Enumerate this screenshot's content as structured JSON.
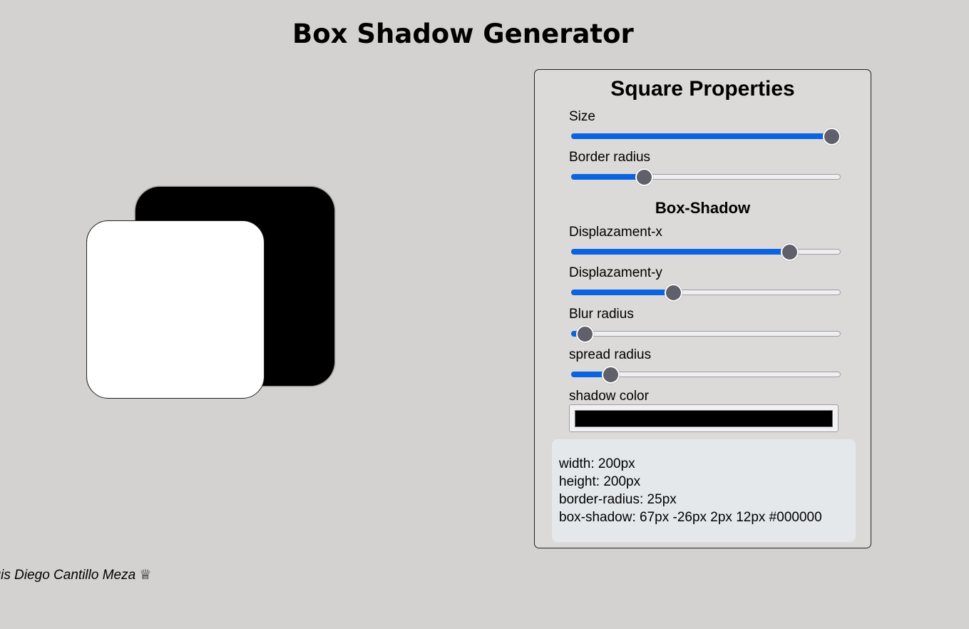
{
  "page": {
    "title": "Box Shadow Generator"
  },
  "panel": {
    "title": "Square Properties",
    "size": {
      "label": "Size",
      "value_fraction": 0.97
    },
    "border_radius": {
      "label": "Border radius",
      "value_fraction": 0.27
    },
    "box_shadow_title": "Box-Shadow",
    "displacement_x": {
      "label": "Displazament-x",
      "value_fraction": 0.815
    },
    "displacement_y": {
      "label": "Displazament-y",
      "value_fraction": 0.38
    },
    "blur_radius": {
      "label": "Blur radius",
      "value_fraction": 0.05
    },
    "spread_radius": {
      "label": "spread radius",
      "value_fraction": 0.145
    },
    "shadow_color": {
      "label": "shadow color",
      "value": "#000000"
    }
  },
  "output": {
    "width": "width: 200px",
    "height": "height: 200px",
    "border_radius": "border-radius: 25px",
    "box_shadow": "box-shadow: 67px -26px 2px 12px #000000"
  },
  "footer": {
    "text": "Luis Diego Cantillo Meza ♕"
  },
  "colors": {
    "background": "#d3d2d0",
    "panel": "#dcdad8",
    "accent": "#0a63e0",
    "thumb": "#60606b",
    "output_bg": "#e5e8eb"
  }
}
